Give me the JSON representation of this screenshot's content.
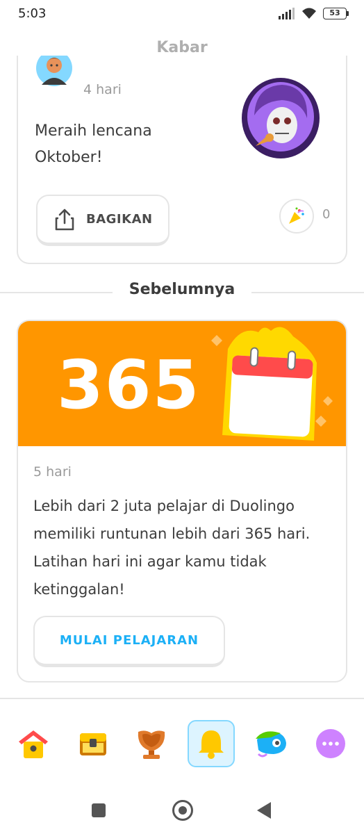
{
  "status_bar": {
    "time": "5:03",
    "battery": "53"
  },
  "header": {
    "title": "Kabar"
  },
  "top_card": {
    "time_ago": "4 hari",
    "message": "Meraih lencana Oktober!",
    "share_label": "BAGIKAN",
    "reaction_count": "0"
  },
  "section": {
    "title": "Sebelumnya"
  },
  "main_card": {
    "banner_number": "365",
    "time_ago": "5 hari",
    "message": "Lebih dari 2 juta pelajar di Duolingo memiliki runtunan lebih dari 365 hari. Latihan hari ini agar kamu tidak ketinggalan!",
    "button_label": "MULAI PELAJARAN"
  },
  "bottom_nav": {
    "items": [
      {
        "icon": "home-icon"
      },
      {
        "icon": "treasure-chest-icon"
      },
      {
        "icon": "trophy-icon"
      },
      {
        "icon": "bell-icon",
        "active": true
      },
      {
        "icon": "bird-character-icon"
      },
      {
        "icon": "more-icon"
      }
    ]
  },
  "colors": {
    "accent_blue": "#1cb0f6",
    "banner_orange": "#ff9600",
    "active_nav_bg": "#ddf4ff",
    "border_gray": "#e5e5e5"
  }
}
